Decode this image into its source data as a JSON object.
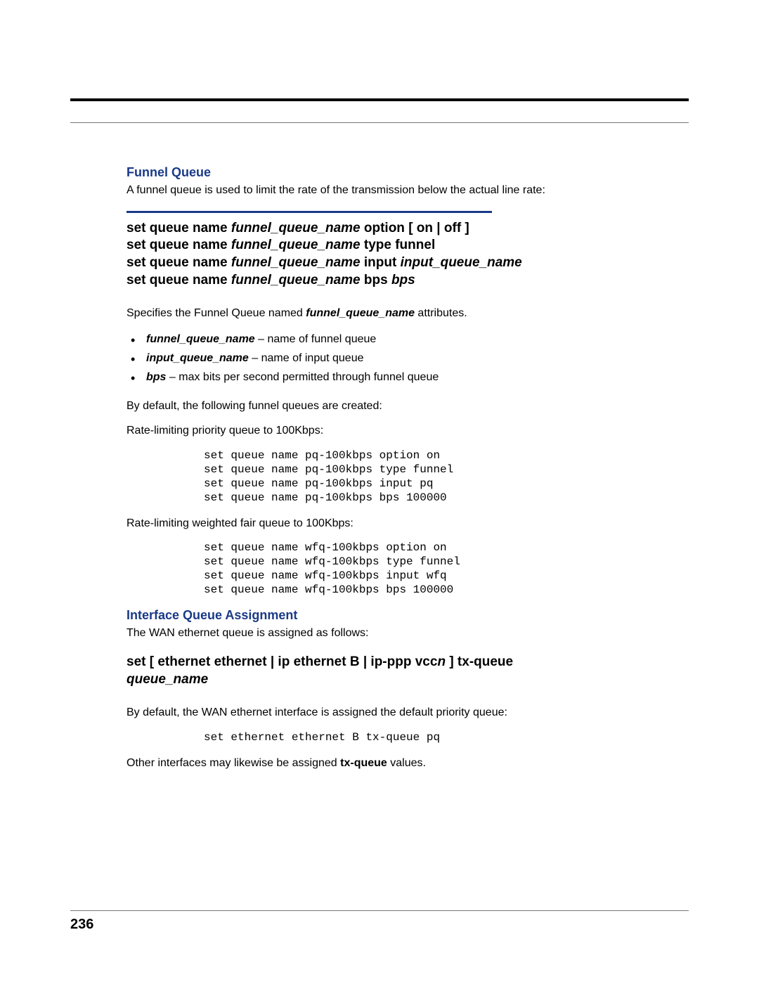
{
  "page_number": "236",
  "sec1": {
    "heading": "Funnel Queue",
    "intro": "A funnel queue is used to limit the rate of the transmission below the actual line rate:",
    "cmd": {
      "l1_pre": "set queue name ",
      "l1_var": "funnel_queue_name",
      "l1_post": " option [ on | off ]",
      "l2_pre": "set queue name ",
      "l2_var": "funnel_queue_name",
      "l2_post": " type funnel",
      "l3_pre": "set queue name ",
      "l3_var": "funnel_queue_name",
      "l3_mid": " input ",
      "l3_var2": "input_queue_name",
      "l4_pre": "set queue name ",
      "l4_var": "funnel_queue_name",
      "l4_mid": " bps ",
      "l4_var2": "bps"
    },
    "desc_pre": "Specifies the Funnel Queue named ",
    "desc_var": "funnel_queue_name",
    "desc_post": " attributes.",
    "bullets": [
      {
        "term": "funnel_queue_name",
        "rest": " – name of funnel queue"
      },
      {
        "term": "input_queue_name",
        "rest": " – name of input queue"
      },
      {
        "term": "bps",
        "rest": " – max bits per second permitted through funnel queue"
      }
    ],
    "p_default": "By default, the following funnel queues are created:",
    "p_rate_pq": "Rate-limiting priority queue to 100Kbps:",
    "code_pq": "set queue name pq-100kbps option on\nset queue name pq-100kbps type funnel\nset queue name pq-100kbps input pq\nset queue name pq-100kbps bps 100000",
    "p_rate_wfq": "Rate-limiting weighted fair queue to 100Kbps:",
    "code_wfq": "set queue name wfq-100kbps option on\nset queue name wfq-100kbps type funnel\nset queue name wfq-100kbps input wfq\nset queue name wfq-100kbps bps 100000"
  },
  "sec2": {
    "heading": "Interface Queue Assignment",
    "intro": "The WAN ethernet queue is assigned as follows:",
    "cmd": {
      "pre": "set [ ethernet ethernet | ip ethernet B | ip-ppp vcc",
      "var_n": "n",
      "mid": " ] tx-queue ",
      "var_q": "queue_name"
    },
    "p_default": "By default, the WAN ethernet interface is assigned the default priority queue:",
    "code": "set ethernet ethernet B tx-queue pq",
    "p_other_pre": "Other interfaces may likewise be assigned ",
    "p_other_bold": "tx-queue",
    "p_other_post": " values."
  }
}
